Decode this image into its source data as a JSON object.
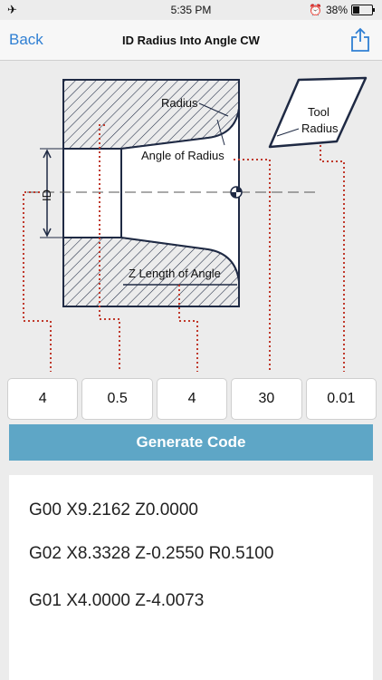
{
  "status": {
    "time": "5:35 PM",
    "battery": "38%",
    "battery_level": 0.38
  },
  "nav": {
    "back": "Back",
    "title": "ID Radius Into Angle CW"
  },
  "diagram": {
    "radius_label": "Radius",
    "tool_label_1": "Tool",
    "tool_label_2": "Radius",
    "angle_label": "Angle of Radius",
    "id_label": "ID",
    "z_label": "Z Length of Angle"
  },
  "inputs": [
    {
      "value": "4"
    },
    {
      "value": "0.5"
    },
    {
      "value": "4"
    },
    {
      "value": "30"
    },
    {
      "value": "0.01"
    }
  ],
  "generate_label": "Generate Code",
  "output": {
    "lines": [
      "G00 X9.2162 Z0.0000",
      "G02 X8.3328 Z-0.2550 R0.5100",
      "G01 X4.0000 Z-4.0073"
    ]
  },
  "colors": {
    "accent": "#2f7fd3",
    "button": "#5ea6c6",
    "guide": "#c0392b",
    "outline": "#1f2a44"
  }
}
